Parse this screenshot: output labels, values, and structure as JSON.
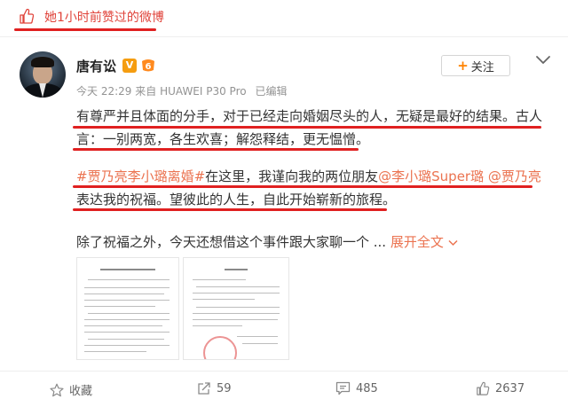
{
  "banner": {
    "text": "她1小时前赞过的微博"
  },
  "author": {
    "name": "唐有讼",
    "verified_glyph": "V",
    "level_label": "6"
  },
  "meta": {
    "time": "今天 22:29",
    "source_prefix": "来自",
    "device": "HUAWEI P30 Pro",
    "edited": "已编辑"
  },
  "follow_button": {
    "plus": "+",
    "label": "关注"
  },
  "post": {
    "line1": "有尊严并且体面的分手，对于已经走向婚姻尽头的人，无疑是最好的结果。古人",
    "line2": "言：一别两宽，各生欢喜；解怨释结，更无愠憎。",
    "hashtag": "#贾乃亮李小璐离婚#",
    "line3_mid": "在这里，我谨向我的两位朋友",
    "mention1": "@李小璐Super璐",
    "mention2": "@贾乃亮",
    "line4": "表达我的祝福。望彼此的人生，自此开始崭新的旅程。",
    "line5": "除了祝福之外，今天还想借这个事件跟大家聊一个 ...",
    "expand": "展开全文"
  },
  "actions": {
    "favorite_label": "收藏",
    "repost_count": "59",
    "comment_count": "485",
    "like_count": "2637"
  },
  "colors": {
    "accent": "#eb7350",
    "annotation_red": "#e02020",
    "follow_plus": "#ff8200"
  }
}
